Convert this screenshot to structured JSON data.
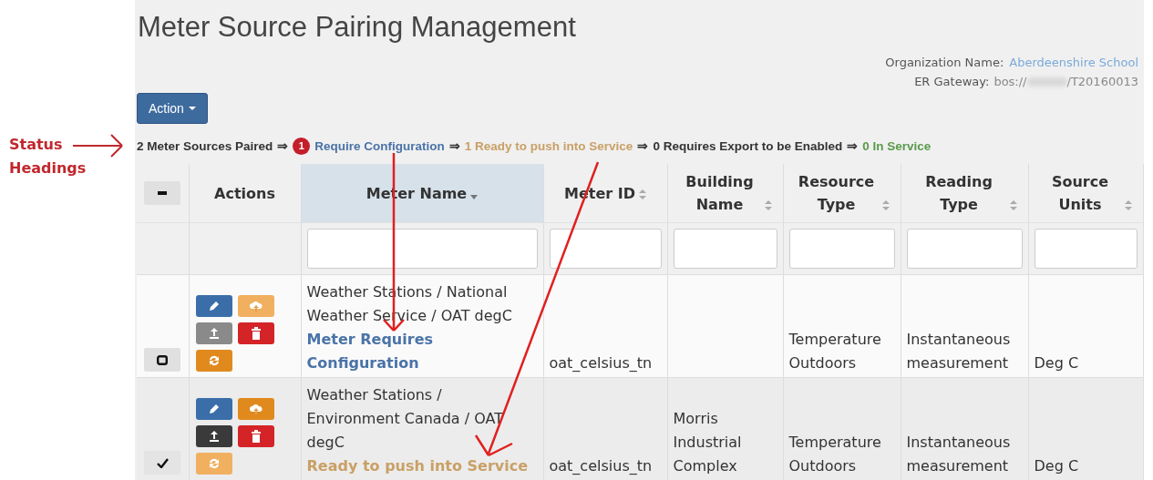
{
  "annotation": {
    "label": "Status\nHeadings"
  },
  "title": "Meter Source Pairing Management",
  "organization": {
    "label": "Organization Name:",
    "value": "Aberdeenshire School"
  },
  "gateway": {
    "label": "ER Gateway:",
    "prefix": "bos://",
    "suffix": "/T20160013"
  },
  "action_button": {
    "label": "Action"
  },
  "status_headings": [
    {
      "text": "2 Meter Sources Paired",
      "color": "#333333",
      "arrow": "⇒"
    },
    {
      "badge": "1",
      "text": "Require Configuration",
      "color": "#4a73a8",
      "arrow": "⇒"
    },
    {
      "text": "1 Ready to push into Service",
      "color": "#c9a066",
      "arrow": "⇒"
    },
    {
      "text": "0 Requires Export to be Enabled",
      "color": "#333333",
      "arrow": "⇒"
    },
    {
      "text": "0 In Service",
      "color": "#5a9a4a"
    }
  ],
  "table": {
    "columns": [
      {
        "label": "Actions"
      },
      {
        "label": "Meter Name",
        "sorted": true,
        "filter": true
      },
      {
        "label": "Meter ID",
        "sorted": false,
        "filter": true
      },
      {
        "label": "Building Name",
        "sorted": false,
        "filter": true
      },
      {
        "label": "Resource Type",
        "sorted": false,
        "filter": true
      },
      {
        "label": "Reading Type",
        "sorted": false,
        "filter": true
      },
      {
        "label": "Source Units",
        "sorted": false,
        "filter": true
      }
    ],
    "rows": [
      {
        "selected": false,
        "actions": [
          {
            "kind": "edit",
            "disabled": false
          },
          {
            "kind": "upload",
            "disabled": true
          },
          {
            "kind": "export",
            "disabled": true
          },
          {
            "kind": "delete",
            "disabled": false
          },
          {
            "kind": "sync",
            "disabled": false
          }
        ],
        "meter_name": "Weather Stations / National Weather Service / OAT degC",
        "status": {
          "kind": "requires_configuration",
          "text": "Meter Requires Configuration"
        },
        "meter_id": "oat_celsius_tn",
        "resource_type": "Temperature Outdoors",
        "reading_type": "Instantaneous measurement",
        "source_units": "Deg C"
      },
      {
        "selected": true,
        "actions": [
          {
            "kind": "edit",
            "disabled": false
          },
          {
            "kind": "upload",
            "disabled": false
          },
          {
            "kind": "export",
            "disabled": false
          },
          {
            "kind": "delete",
            "disabled": false
          },
          {
            "kind": "sync",
            "disabled": true
          }
        ],
        "meter_name": "Weather Stations / Environment Canada / OAT degC",
        "status": {
          "kind": "ready",
          "text": "Ready to push into Service"
        },
        "meter_id": "oat_celsius_tn",
        "building_name": "Morris Industrial Complex",
        "resource_type": "Temperature Outdoors",
        "reading_type": "Instantaneous measurement",
        "source_units": "Deg C"
      }
    ]
  }
}
